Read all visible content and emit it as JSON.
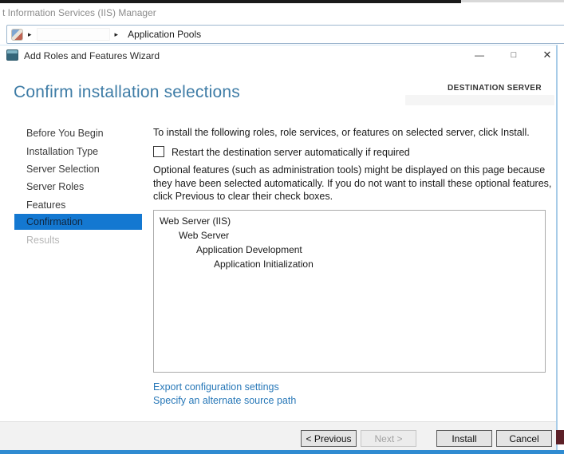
{
  "background_window": {
    "title": "t Information Services (IIS) Manager",
    "breadcrumb": {
      "arrow": "▸",
      "crumb": "Application Pools"
    }
  },
  "wizard": {
    "title": "Add Roles and Features Wizard",
    "window_controls": {
      "minimize": "—",
      "maximize": "□",
      "close": "✕"
    },
    "heading": "Confirm installation selections",
    "destination_label": "DESTINATION SERVER",
    "sidebar": {
      "items": [
        {
          "label": "Before You Begin",
          "state": "normal"
        },
        {
          "label": "Installation Type",
          "state": "normal"
        },
        {
          "label": "Server Selection",
          "state": "normal"
        },
        {
          "label": "Server Roles",
          "state": "normal"
        },
        {
          "label": "Features",
          "state": "normal"
        },
        {
          "label": "Confirmation",
          "state": "selected"
        },
        {
          "label": "Results",
          "state": "disabled"
        }
      ]
    },
    "content": {
      "intro": "To install the following roles, role services, or features on selected server, click Install.",
      "restart_checkbox": {
        "checked": false,
        "label": "Restart the destination server automatically if required"
      },
      "optional_note": "Optional features (such as administration tools) might be displayed on this page because they have been selected automatically. If you do not want to install these optional features, click Previous to clear their check boxes.",
      "tree": [
        {
          "label": "Web Server (IIS)",
          "indent": 0
        },
        {
          "label": "Web Server",
          "indent": 1
        },
        {
          "label": "Application Development",
          "indent": 2
        },
        {
          "label": "Application Initialization",
          "indent": 3
        }
      ],
      "links": [
        {
          "label": "Export configuration settings"
        },
        {
          "label": "Specify an alternate source path"
        }
      ]
    },
    "buttons": [
      {
        "label": "< Previous",
        "enabled": true
      },
      {
        "label": "Next >",
        "enabled": false
      },
      {
        "label": "Install",
        "enabled": true
      },
      {
        "label": "Cancel",
        "enabled": true
      }
    ]
  },
  "colors": {
    "accent_selected": "#1478d1",
    "heading": "#3e7ca6",
    "link": "#2878b8",
    "window_border": "#2f8bd1"
  }
}
